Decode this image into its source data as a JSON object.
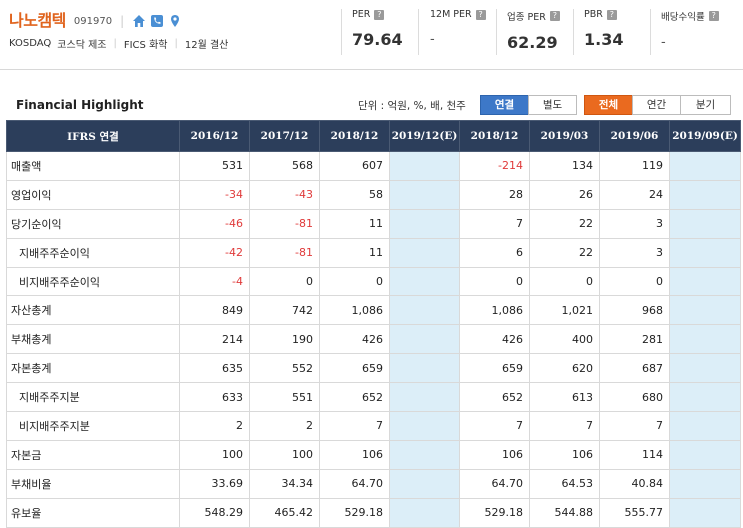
{
  "company": {
    "name": "나노캠텍",
    "code": "091970",
    "market": "KOSDAQ",
    "sector": "코스닥 제조",
    "industry": "FICS 화학",
    "fiscal": "12월 결산"
  },
  "metrics": [
    {
      "label": "PER",
      "value": "79.64"
    },
    {
      "label": "12M PER",
      "value": "-"
    },
    {
      "label": "업종 PER",
      "value": "62.29"
    },
    {
      "label": "PBR",
      "value": "1.34"
    },
    {
      "label": "배당수익률",
      "value": "-"
    }
  ],
  "section": {
    "title": "Financial Highlight",
    "unit": "단위 : 억원, %, 배, 천주",
    "buttons": {
      "consolidated": "연결",
      "separate": "별도",
      "all": "전체",
      "annual": "연간",
      "quarterly": "분기"
    }
  },
  "table": {
    "header_label": "IFRS 연결",
    "columns": [
      "2016/12",
      "2017/12",
      "2018/12",
      "2019/12(E)",
      "2018/12",
      "2019/03",
      "2019/06",
      "2019/09(E)"
    ],
    "rows": [
      {
        "label": "매출액",
        "sub": false,
        "values": [
          "531",
          "568",
          "607",
          "",
          "-214",
          "134",
          "119",
          ""
        ]
      },
      {
        "label": "영업이익",
        "sub": false,
        "values": [
          "-34",
          "-43",
          "58",
          "",
          "28",
          "26",
          "24",
          ""
        ]
      },
      {
        "label": "당기순이익",
        "sub": false,
        "values": [
          "-46",
          "-81",
          "11",
          "",
          "7",
          "22",
          "3",
          ""
        ]
      },
      {
        "label": "지배주주순이익",
        "sub": true,
        "values": [
          "-42",
          "-81",
          "11",
          "",
          "6",
          "22",
          "3",
          ""
        ]
      },
      {
        "label": "비지배주주순이익",
        "sub": true,
        "values": [
          "-4",
          "0",
          "0",
          "",
          "0",
          "0",
          "0",
          ""
        ]
      },
      {
        "label": "자산총계",
        "sub": false,
        "values": [
          "849",
          "742",
          "1,086",
          "",
          "1,086",
          "1,021",
          "968",
          ""
        ]
      },
      {
        "label": "부채총계",
        "sub": false,
        "values": [
          "214",
          "190",
          "426",
          "",
          "426",
          "400",
          "281",
          ""
        ]
      },
      {
        "label": "자본총계",
        "sub": false,
        "values": [
          "635",
          "552",
          "659",
          "",
          "659",
          "620",
          "687",
          ""
        ]
      },
      {
        "label": "지배주주지분",
        "sub": true,
        "values": [
          "633",
          "551",
          "652",
          "",
          "652",
          "613",
          "680",
          ""
        ]
      },
      {
        "label": "비지배주주지분",
        "sub": true,
        "values": [
          "2",
          "2",
          "7",
          "",
          "7",
          "7",
          "7",
          ""
        ]
      },
      {
        "label": "자본금",
        "sub": false,
        "values": [
          "100",
          "100",
          "106",
          "",
          "106",
          "106",
          "114",
          ""
        ]
      },
      {
        "label": "부채비율",
        "sub": false,
        "values": [
          "33.69",
          "34.34",
          "64.70",
          "",
          "64.70",
          "64.53",
          "40.84",
          ""
        ]
      },
      {
        "label": "유보율",
        "sub": false,
        "values": [
          "548.29",
          "465.42",
          "529.18",
          "",
          "529.18",
          "544.88",
          "555.77",
          ""
        ]
      }
    ]
  },
  "colors": {
    "brand": "#e0641e",
    "header_bg": "#2c3e5b",
    "estimate_bg": "#dceef8",
    "negative": "#e03a3a",
    "active_blue": "#3d78c8",
    "active_orange": "#ea6a1f",
    "icon": "#4a8fd4"
  },
  "icons": [
    "home-icon",
    "phone-icon",
    "location-pin-icon",
    "help-icon"
  ]
}
